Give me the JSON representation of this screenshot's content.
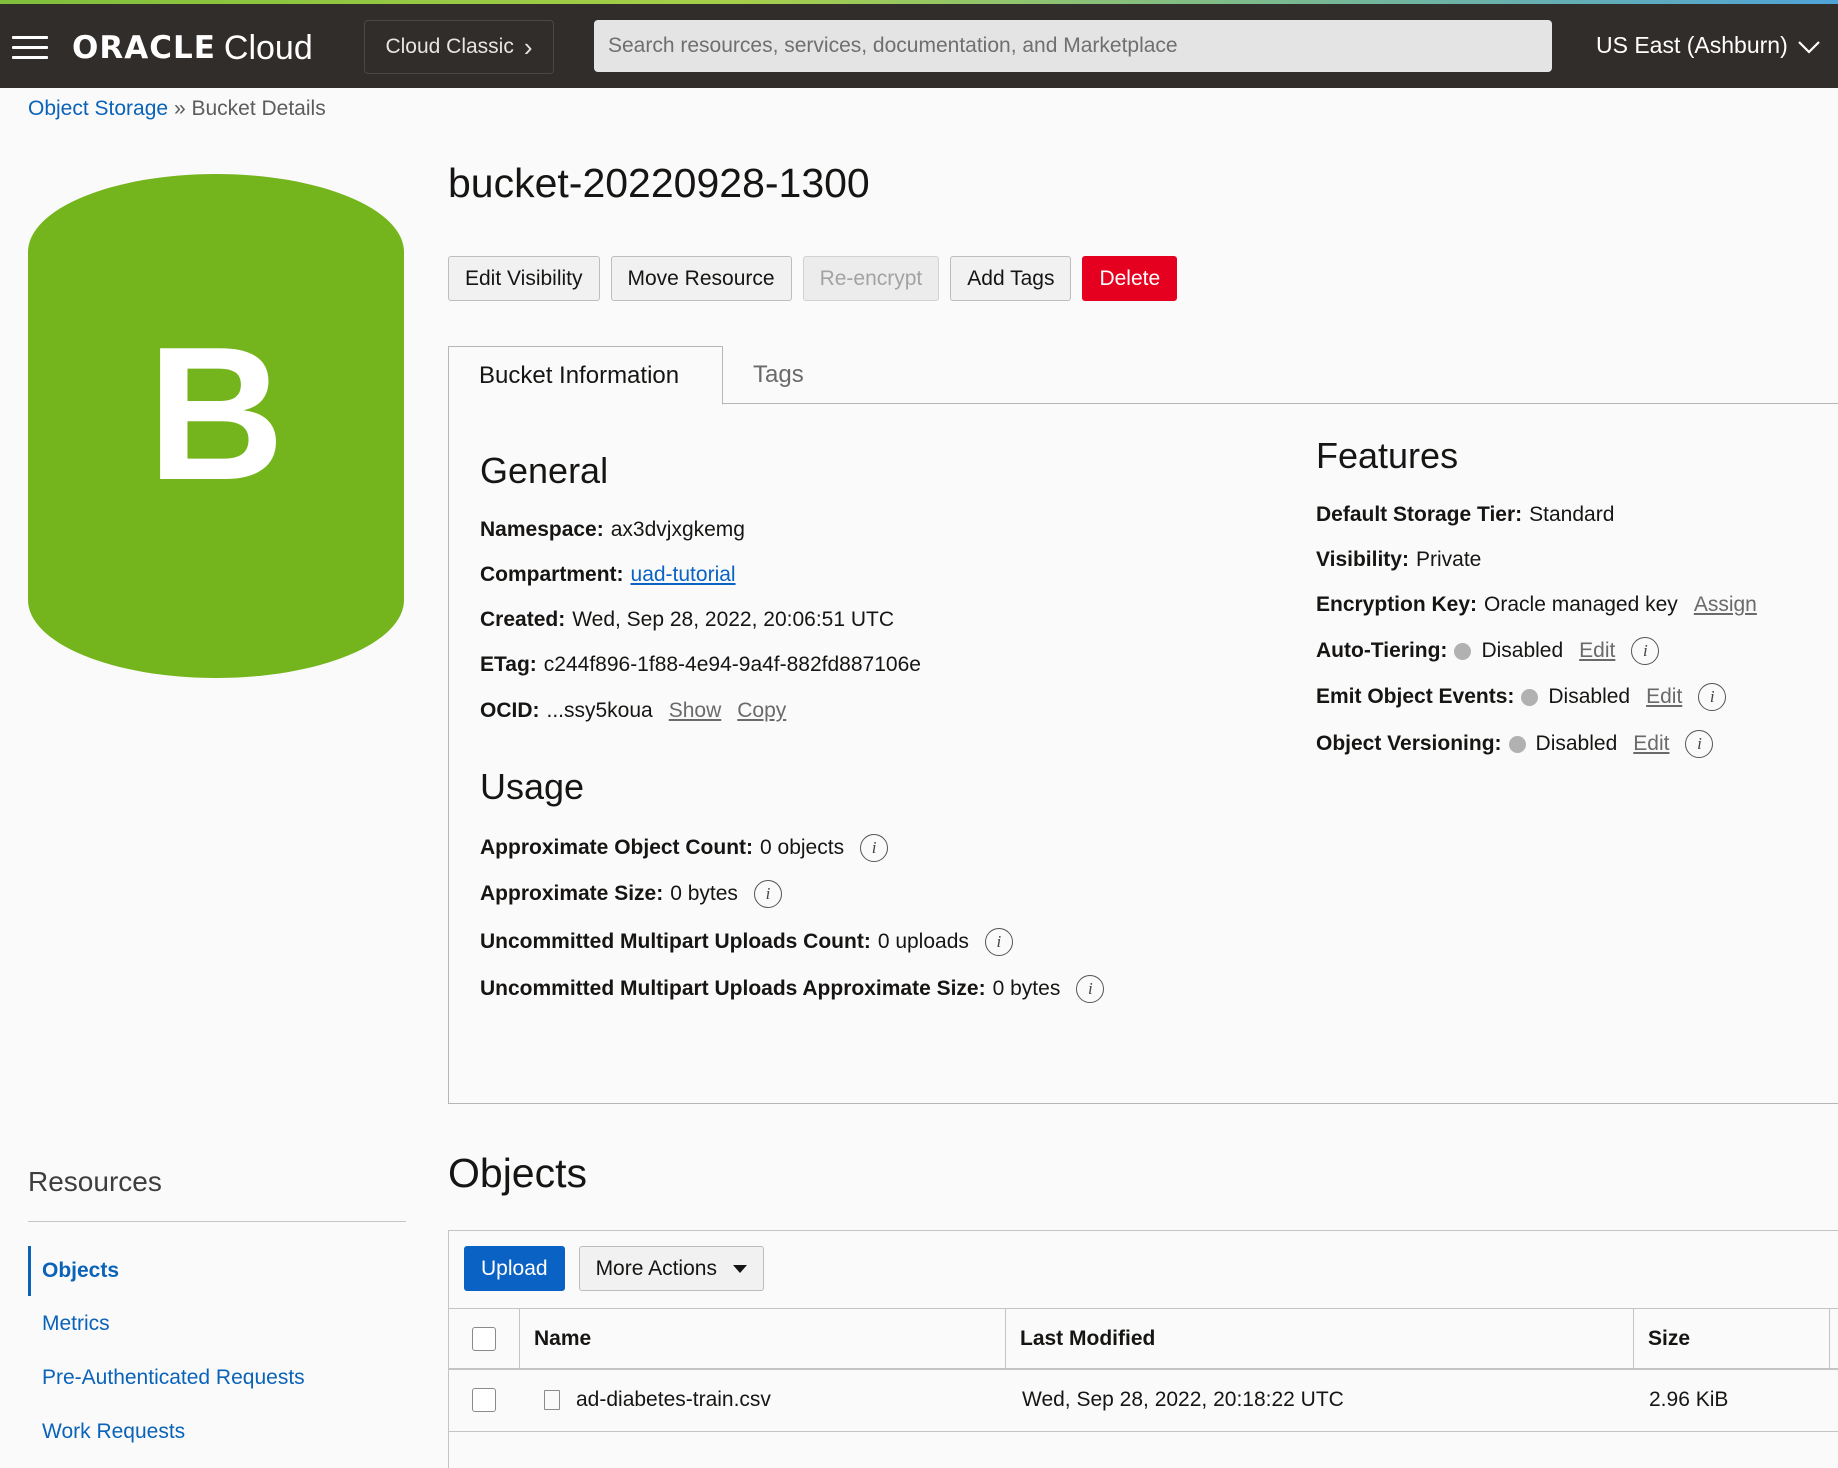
{
  "header": {
    "brand_oracle": "ORACLE",
    "brand_cloud": "Cloud",
    "classic_label": "Cloud Classic",
    "search_placeholder": "Search resources, services, documentation, and Marketplace",
    "region": "US East (Ashburn)"
  },
  "breadcrumb": {
    "parent": "Object Storage",
    "separator": "»",
    "current": "Bucket Details"
  },
  "badge_letter": "B",
  "badge_color": "#74b41d",
  "page_title": "bucket-20220928-1300",
  "actions": {
    "edit_visibility": "Edit Visibility",
    "move_resource": "Move Resource",
    "reencrypt": "Re-encrypt",
    "add_tags": "Add Tags",
    "delete": "Delete"
  },
  "tabs": {
    "bucket_info": "Bucket Information",
    "tags": "Tags"
  },
  "general": {
    "heading": "General",
    "namespace_label": "Namespace:",
    "namespace_value": "ax3dvjxgkemg",
    "compartment_label": "Compartment:",
    "compartment_value": "uad-tutorial",
    "created_label": "Created:",
    "created_value": "Wed, Sep 28, 2022, 20:06:51 UTC",
    "etag_label": "ETag:",
    "etag_value": "c244f896-1f88-4e94-9a4f-882fd887106e",
    "ocid_label": "OCID:",
    "ocid_value": "...ssy5koua",
    "show_link": "Show",
    "copy_link": "Copy"
  },
  "usage": {
    "heading": "Usage",
    "object_count_label": "Approximate Object Count:",
    "object_count_value": "0 objects",
    "size_label": "Approximate Size:",
    "size_value": "0 bytes",
    "multipart_count_label": "Uncommitted Multipart Uploads Count:",
    "multipart_count_value": "0 uploads",
    "multipart_size_label": "Uncommitted Multipart Uploads Approximate Size:",
    "multipart_size_value": "0 bytes"
  },
  "features": {
    "heading": "Features",
    "storage_tier_label": "Default Storage Tier:",
    "storage_tier_value": "Standard",
    "visibility_label": "Visibility:",
    "visibility_value": "Private",
    "encryption_label": "Encryption Key:",
    "encryption_value": "Oracle managed key",
    "assign_link": "Assign",
    "auto_tiering_label": "Auto-Tiering:",
    "auto_tiering_value": "Disabled",
    "emit_events_label": "Emit Object Events:",
    "emit_events_value": "Disabled",
    "versioning_label": "Object Versioning:",
    "versioning_value": "Disabled",
    "edit_link": "Edit",
    "info_glyph": "i"
  },
  "resources": {
    "heading": "Resources",
    "items": [
      "Objects",
      "Metrics",
      "Pre-Authenticated Requests",
      "Work Requests"
    ]
  },
  "objects": {
    "heading": "Objects",
    "upload": "Upload",
    "more_actions": "More Actions",
    "columns": [
      "Name",
      "Last Modified",
      "Size"
    ],
    "rows": [
      {
        "name": "ad-diabetes-train.csv",
        "modified": "Wed, Sep 28, 2022, 20:18:22 UTC",
        "size": "2.96 KiB"
      }
    ]
  }
}
